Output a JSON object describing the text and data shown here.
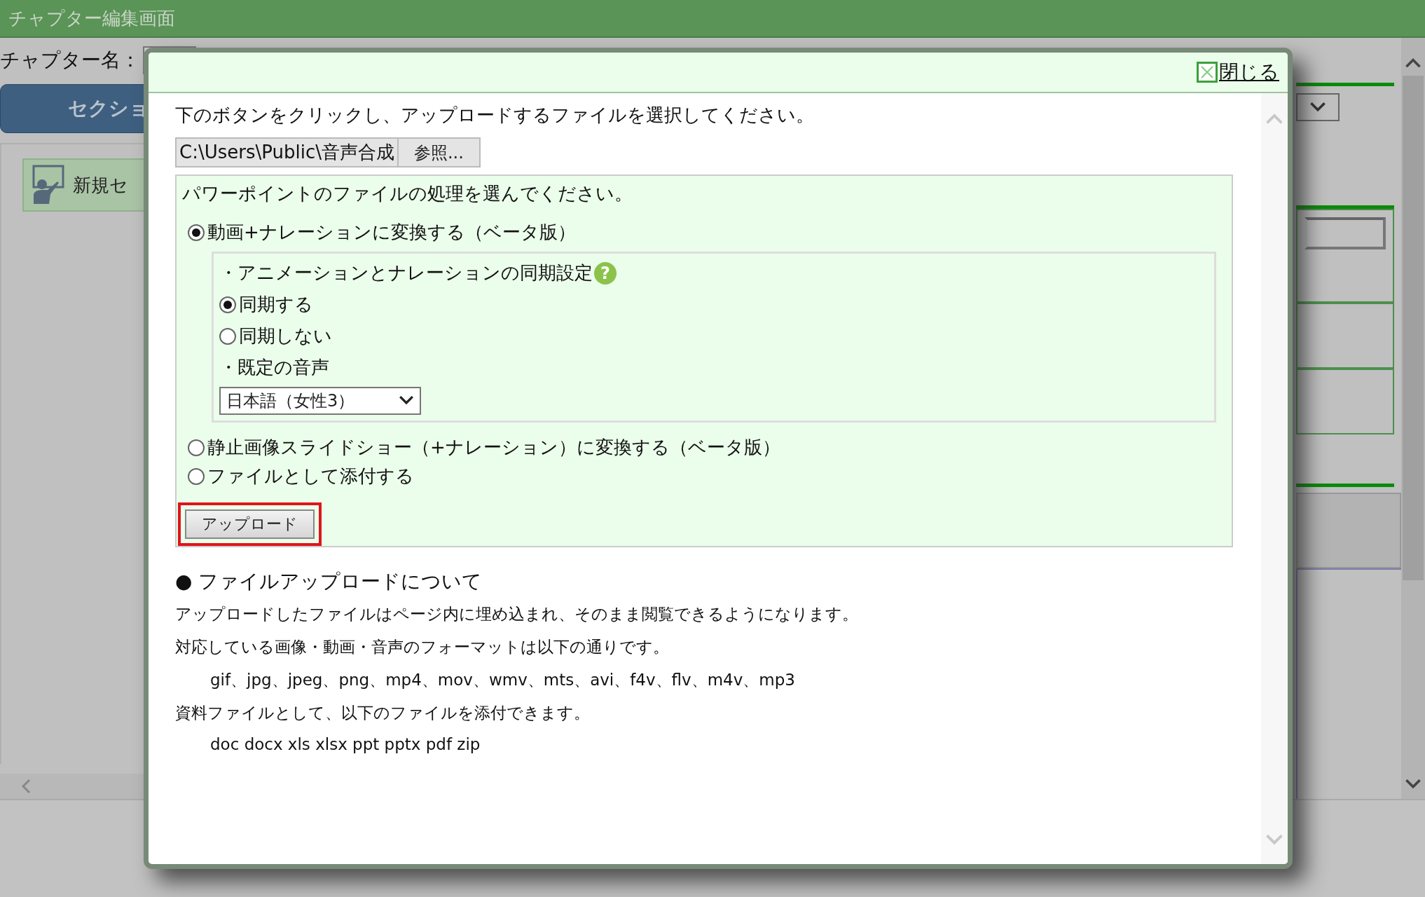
{
  "app_title": "チャプター編集画面",
  "background": {
    "chapter_name_label": "チャプター名：",
    "section_button": "セクショ",
    "item_label": "新規セ"
  },
  "dialog": {
    "close_link": "閉じる",
    "instruction": "下のボタンをクリックし、アップロードするファイルを選択してください。",
    "file_input": {
      "value": "C:\\Users\\Public\\音声合成",
      "browse_button": "参照..."
    },
    "options_prompt": "パワーポイントのファイルの処理を選んでください。",
    "options": [
      {
        "label": "動画+ナレーションに変換する（ベータ版）",
        "selected": true
      },
      {
        "label": "静止画像スライドショー（+ナレーション）に変換する（ベータ版）",
        "selected": false
      },
      {
        "label": "ファイルとして添付する",
        "selected": false
      }
    ],
    "settings": {
      "sync_heading": "・アニメーションとナレーションの同期設定",
      "help_icon": "?",
      "sync_options": [
        {
          "label": "同期する",
          "selected": true
        },
        {
          "label": "同期しない",
          "selected": false
        }
      ],
      "voice_heading": "・既定の音声",
      "voice_select": "日本語（女性3）"
    },
    "upload_button": {
      "label": "アップロード",
      "highlighted": true
    },
    "info": {
      "heading": "● ファイルアップロードについて",
      "lines": [
        {
          "text": "アップロードしたファイルはページ内に埋め込まれ、そのまま閲覧できるようになります。",
          "indented": false
        },
        {
          "text": "対応している画像・動画・音声のフォーマットは以下の通りです。",
          "indented": false
        },
        {
          "text": "gif、jpg、jpeg、png、mp4、mov、wmv、mts、avi、f4v、flv、m4v、mp3",
          "indented": true
        },
        {
          "text": "資料ファイルとして、以下のファイルを添付できます。",
          "indented": false
        },
        {
          "text": "doc docx xls xlsx ppt pptx pdf zip",
          "indented": true
        }
      ]
    }
  }
}
